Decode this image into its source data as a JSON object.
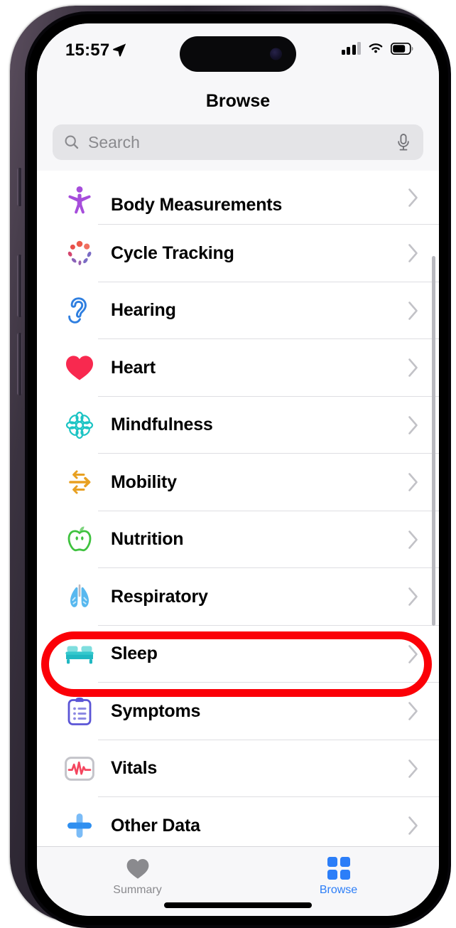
{
  "status_bar": {
    "time": "15:57",
    "location_icon": "location-arrow-icon",
    "cellular_icon": "cellular-signal-icon",
    "wifi_icon": "wifi-icon",
    "battery_icon": "battery-icon"
  },
  "nav": {
    "title": "Browse"
  },
  "search": {
    "placeholder": "Search",
    "value": "",
    "search_icon": "search-icon",
    "mic_icon": "microphone-icon"
  },
  "list": {
    "items": [
      {
        "label": "Body Measurements",
        "icon": "body-measurements-icon",
        "color": "#a64ddb"
      },
      {
        "label": "Cycle Tracking",
        "icon": "cycle-tracking-icon",
        "color": "#ec5a4b"
      },
      {
        "label": "Hearing",
        "icon": "hearing-icon",
        "color": "#2f7fe0"
      },
      {
        "label": "Heart",
        "icon": "heart-icon",
        "color": "#f8294f"
      },
      {
        "label": "Mindfulness",
        "icon": "mindfulness-icon",
        "color": "#1cc4c4"
      },
      {
        "label": "Mobility",
        "icon": "mobility-icon",
        "color": "#e8a021"
      },
      {
        "label": "Nutrition",
        "icon": "nutrition-icon",
        "color": "#3fc23f"
      },
      {
        "label": "Respiratory",
        "icon": "respiratory-icon",
        "color": "#57b8ef"
      },
      {
        "label": "Sleep",
        "icon": "sleep-icon",
        "color": "#34c8cd"
      },
      {
        "label": "Symptoms",
        "icon": "symptoms-icon",
        "color": "#5b55d6"
      },
      {
        "label": "Vitals",
        "icon": "vitals-icon",
        "color": "#f4465f"
      },
      {
        "label": "Other Data",
        "icon": "other-data-icon",
        "color": "#2f8ff0"
      }
    ]
  },
  "annotation": {
    "highlighted_item": "Sleep",
    "shape": "rounded-rectangle",
    "color": "#fb0007"
  },
  "tab_bar": {
    "tabs": [
      {
        "label": "Summary",
        "icon": "heart-icon",
        "active": false
      },
      {
        "label": "Browse",
        "icon": "grid-squares-icon",
        "active": true
      }
    ],
    "active_color": "#2c7ef8",
    "inactive_color": "#8a8a8e"
  }
}
